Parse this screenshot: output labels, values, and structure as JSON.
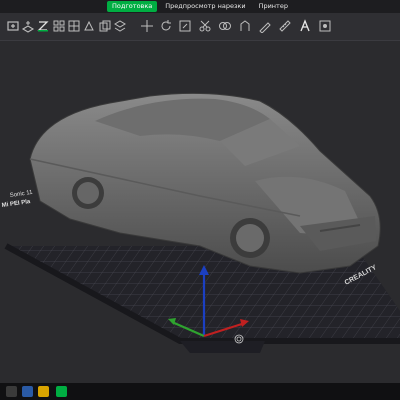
{
  "app": {
    "tabs": [
      {
        "label": "Подготовка",
        "active": true
      },
      {
        "label": "Предпросмотр нарезки",
        "active": false
      },
      {
        "label": "Принтер",
        "active": false
      }
    ],
    "accent": "#00ae42"
  },
  "toolbar": {
    "icons": [
      "add-object-icon",
      "add-plate-icon",
      "orient-icon",
      "auto-arrange-icon",
      "grid-view-icon",
      "split-icon",
      "copy-icon",
      "layer-icon",
      "move-icon",
      "rotate-icon",
      "scale-icon",
      "cut-icon",
      "mesh-boolean-icon",
      "support-paint-icon",
      "seam-paint-icon",
      "measure-icon",
      "text-icon",
      "color-paint-icon"
    ]
  },
  "plate": {
    "brand": "CREALITY",
    "left_labels": [
      "Sonic 11",
      "Mi PEI Pla"
    ]
  },
  "taskbar": {
    "icons": [
      "start-icon",
      "search-icon",
      "folder-icon",
      "slicer-app-icon"
    ]
  }
}
